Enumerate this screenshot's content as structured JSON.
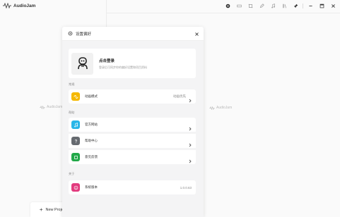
{
  "app": {
    "title": "AudioJam",
    "toolbar_icons": [
      "settings-gear-icon",
      "layout-icon",
      "crop-icon",
      "pencil-icon",
      "music-note-icon",
      "library-icon",
      "pin-icon"
    ],
    "window_controls": [
      "minimize-icon",
      "maximize-icon",
      "close-icon"
    ]
  },
  "workspace": {
    "ghost_left": "AudioJam",
    "ghost_right": "AudioJam",
    "new_project_label": "New Project"
  },
  "modal": {
    "title": "设置偏好",
    "login": {
      "title": "点击登录",
      "subtitle": "登录后可同步你的偏好设置和项目资料"
    },
    "sections": {
      "general": "常规",
      "help": "帮助",
      "about": "关于"
    },
    "rows": {
      "animation": {
        "label": "动画模式",
        "value": "动画优先"
      },
      "website": {
        "label": "官方网站"
      },
      "help_center": {
        "label": "帮助中心"
      },
      "feedback": {
        "label": "意见反馈"
      },
      "version": {
        "label": "系统版本",
        "value": "1.0.0.63"
      }
    }
  },
  "colors": {
    "animation_icon": "#f5b800",
    "website_icon": "#29b6e8",
    "help_icon": "#666a70",
    "feedback_icon": "#22a849",
    "version_icon": "#e23b7e"
  }
}
